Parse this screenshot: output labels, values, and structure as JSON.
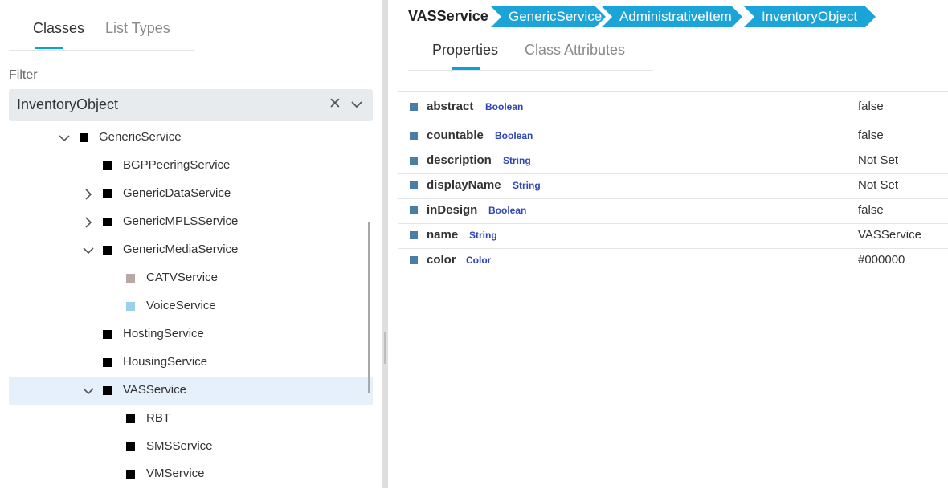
{
  "left_tabs": {
    "classes": "Classes",
    "list_types": "List Types"
  },
  "filter": {
    "label": "Filter",
    "value": "InventoryObject"
  },
  "tree": {
    "items": [
      {
        "label": "GenericService",
        "expanded": true,
        "square_color": "#000000"
      },
      {
        "label": "BGPPeeringService",
        "square_color": "#000000"
      },
      {
        "label": "GenericDataService",
        "expanded": false,
        "square_color": "#000000"
      },
      {
        "label": "GenericMPLSService",
        "expanded": false,
        "square_color": "#000000"
      },
      {
        "label": "GenericMediaService",
        "expanded": true,
        "square_color": "#000000"
      },
      {
        "label": "CATVService",
        "square_color": "#b9a9a4"
      },
      {
        "label": "VoiceService",
        "square_color": "#9ccfee"
      },
      {
        "label": "HostingService",
        "square_color": "#000000"
      },
      {
        "label": "HousingService",
        "square_color": "#000000"
      },
      {
        "label": "VASService",
        "expanded": true,
        "selected": true,
        "square_color": "#000000"
      },
      {
        "label": "RBT",
        "square_color": "#000000"
      },
      {
        "label": "SMSService",
        "square_color": "#000000"
      },
      {
        "label": "VMService",
        "square_color": "#000000"
      }
    ]
  },
  "breadcrumb": {
    "title": "VASService",
    "items": [
      "GenericService",
      "AdministrativeItem",
      "InventoryObject"
    ],
    "chip_color": "#1aa4d8"
  },
  "right_tabs": {
    "properties": "Properties",
    "class_attributes": "Class Attributes"
  },
  "properties": [
    {
      "name": "abstract",
      "type": "Boolean",
      "value": "false"
    },
    {
      "name": "countable",
      "type": "Boolean",
      "value": "false"
    },
    {
      "name": "description",
      "type": "String",
      "value": "Not Set"
    },
    {
      "name": "displayName",
      "type": "String",
      "value": "Not Set"
    },
    {
      "name": "inDesign",
      "type": "Boolean",
      "value": "false"
    },
    {
      "name": "name",
      "type": "String",
      "value": "VASService"
    },
    {
      "name": "color",
      "type": "Color",
      "value": "#000000"
    }
  ],
  "colors": {
    "accent": "#00a6d6",
    "selected_row": "#e6f0fb",
    "type_label": "#2f46b8",
    "property_marker": "#4a7ea5"
  }
}
